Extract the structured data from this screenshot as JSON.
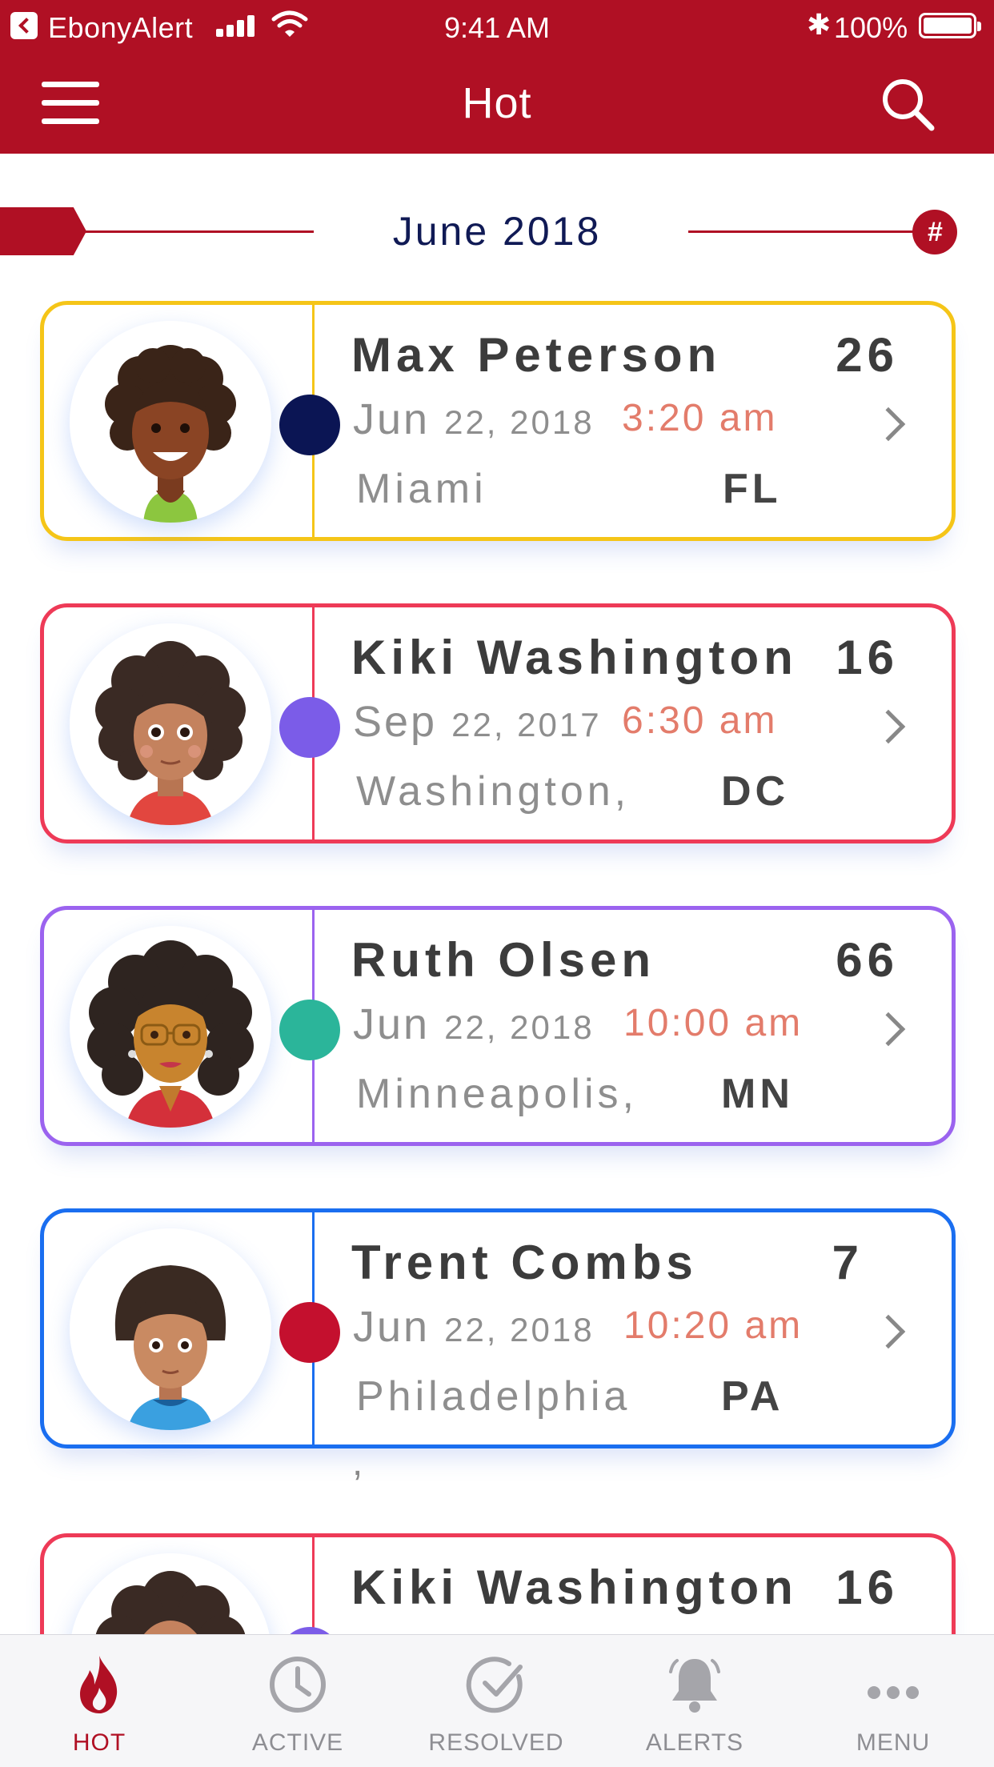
{
  "status_bar": {
    "carrier": "EbonyAlert",
    "time": "9:41 AM",
    "bluetooth": "✱",
    "battery": "100%"
  },
  "nav": {
    "title": "Hot",
    "menu_icon": "hamburger-icon",
    "search_icon": "search-icon"
  },
  "month": {
    "label": "June 2018",
    "badge": "#"
  },
  "colors": {
    "brand": "#b01024",
    "time_text": "#e37c6b"
  },
  "cards": [
    {
      "name": "Max Peterson",
      "age": "26",
      "date_month": "Jun",
      "date_rest": "22, 2018",
      "time": "3:20 am",
      "city": "Miami",
      "state": "FL",
      "border": "#f5c518",
      "dot": "#0b1554",
      "avatar": "boy-avatar"
    },
    {
      "name": "Kiki Washington",
      "age": "16",
      "date_month": "Sep",
      "date_rest": "22, 2017",
      "time": "6:30 am",
      "city": "Washington,",
      "state": "DC",
      "border": "#ee3a57",
      "dot": "#7b5ce8",
      "avatar": "girl-avatar"
    },
    {
      "name": "Ruth Olsen",
      "age": "66",
      "date_month": "Jun",
      "date_rest": "22, 2018",
      "time": "10:00 am",
      "city": "Minneapolis,",
      "state": "MN",
      "border": "#9b63ef",
      "dot": "#2bb59a",
      "avatar": "woman-avatar"
    },
    {
      "name": "Trent Combs",
      "age": "7",
      "date_month": "Jun",
      "date_rest": "22, 2018",
      "time": "10:20 am",
      "city": "Philadelphia",
      "state": "PA",
      "border": "#1a6ef0",
      "dot": "#c4102e",
      "avatar": "child-avatar"
    },
    {
      "name": "Kiki Washington",
      "age": "16",
      "border": "#ee3a57",
      "dot": "#7b5ce8",
      "avatar": "girl-avatar"
    }
  ],
  "stray_text": ",",
  "tabs": [
    {
      "label": "HOT",
      "icon": "flame-icon",
      "active": true
    },
    {
      "label": "ACTIVE",
      "icon": "clock-icon",
      "active": false
    },
    {
      "label": "RESOLVED",
      "icon": "check-circle-icon",
      "active": false
    },
    {
      "label": "ALERTS",
      "icon": "bell-icon",
      "active": false
    },
    {
      "label": "MENU",
      "icon": "more-dots-icon",
      "active": false
    }
  ]
}
